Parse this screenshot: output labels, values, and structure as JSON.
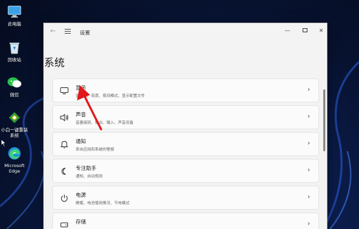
{
  "desktop": {
    "icons": [
      {
        "label": "此电脑",
        "icon": "computer-icon"
      },
      {
        "label": "回收站",
        "icon": "recycle-bin-icon"
      },
      {
        "label": "微信",
        "icon": "wechat-icon"
      },
      {
        "label": "小白一键重装系统",
        "icon": "reinstall-tool-icon"
      },
      {
        "label": "Microsoft Edge",
        "icon": "edge-icon"
      }
    ]
  },
  "window": {
    "title": "设置",
    "back_icon": "back-arrow-icon",
    "menu_icon": "hamburger-menu-icon",
    "controls": [
      "minimize",
      "maximize",
      "close"
    ]
  },
  "page": {
    "title": "系统",
    "items": [
      {
        "title": "显示",
        "subtitle": "监视器、亮度、夜间模式、显示配置文件",
        "icon": "monitor-icon"
      },
      {
        "title": "声音",
        "subtitle": "音量级别、输出、输入、声音设备",
        "icon": "speaker-icon"
      },
      {
        "title": "通知",
        "subtitle": "来自应用和系统的警报",
        "icon": "bell-icon"
      },
      {
        "title": "专注助手",
        "subtitle": "通知、自动规则",
        "icon": "moon-icon"
      },
      {
        "title": "电源",
        "subtitle": "睡眠、电池使用情况、节电模式",
        "icon": "power-icon"
      },
      {
        "title": "存储",
        "subtitle": "",
        "icon": "storage-icon"
      }
    ]
  },
  "colors": {
    "annotation_arrow": "#e0181b",
    "window_bg": "#f3f3f3",
    "card_bg": "#fbfbfb"
  }
}
